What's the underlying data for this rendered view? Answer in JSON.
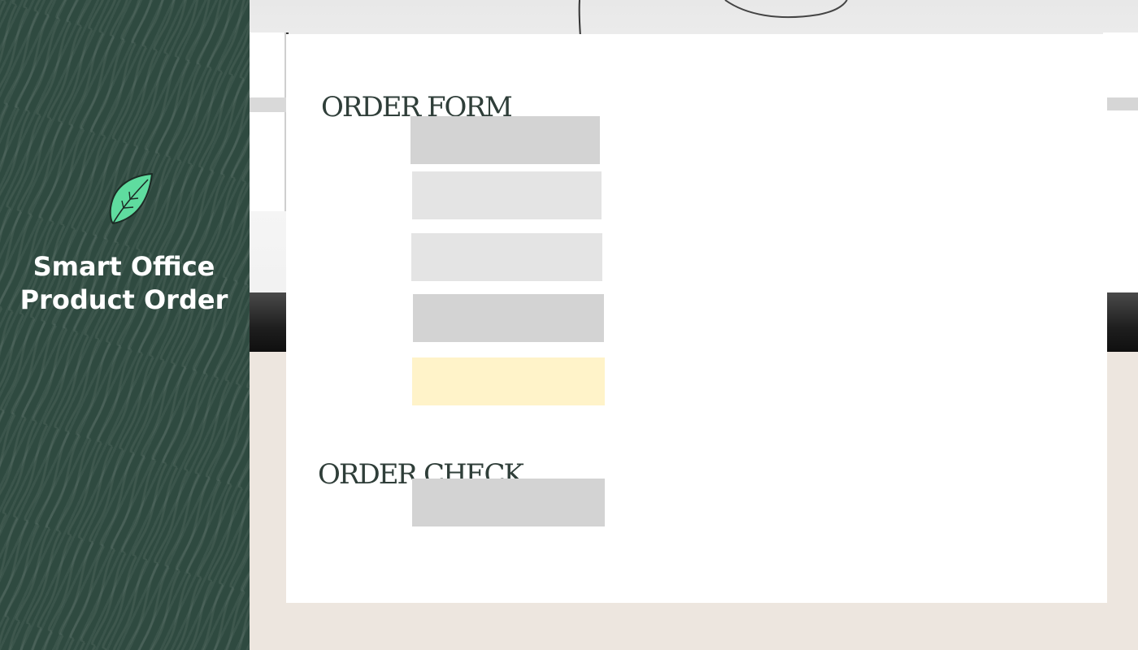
{
  "sidebar": {
    "icon": "leaf-icon",
    "brand_line1": "Smart Office",
    "brand_line2": "Product Order",
    "background_color": "#2f4a40",
    "leaf_color": "#5fdc9f"
  },
  "main": {
    "background_color": "#ede6df",
    "order_form": {
      "title": "ORDER FORM",
      "fields": [
        {
          "value": "",
          "color": "#d3d3d3"
        },
        {
          "value": "",
          "color": "#e4e4e4"
        },
        {
          "value": "",
          "color": "#e4e4e4"
        },
        {
          "value": "",
          "color": "#d3d3d3"
        }
      ],
      "submit": {
        "label": "",
        "color": "#fff3c9"
      }
    },
    "order_check": {
      "title": "ORDER CHECK",
      "button": {
        "label": "",
        "color": "#d3d3d3"
      }
    }
  }
}
